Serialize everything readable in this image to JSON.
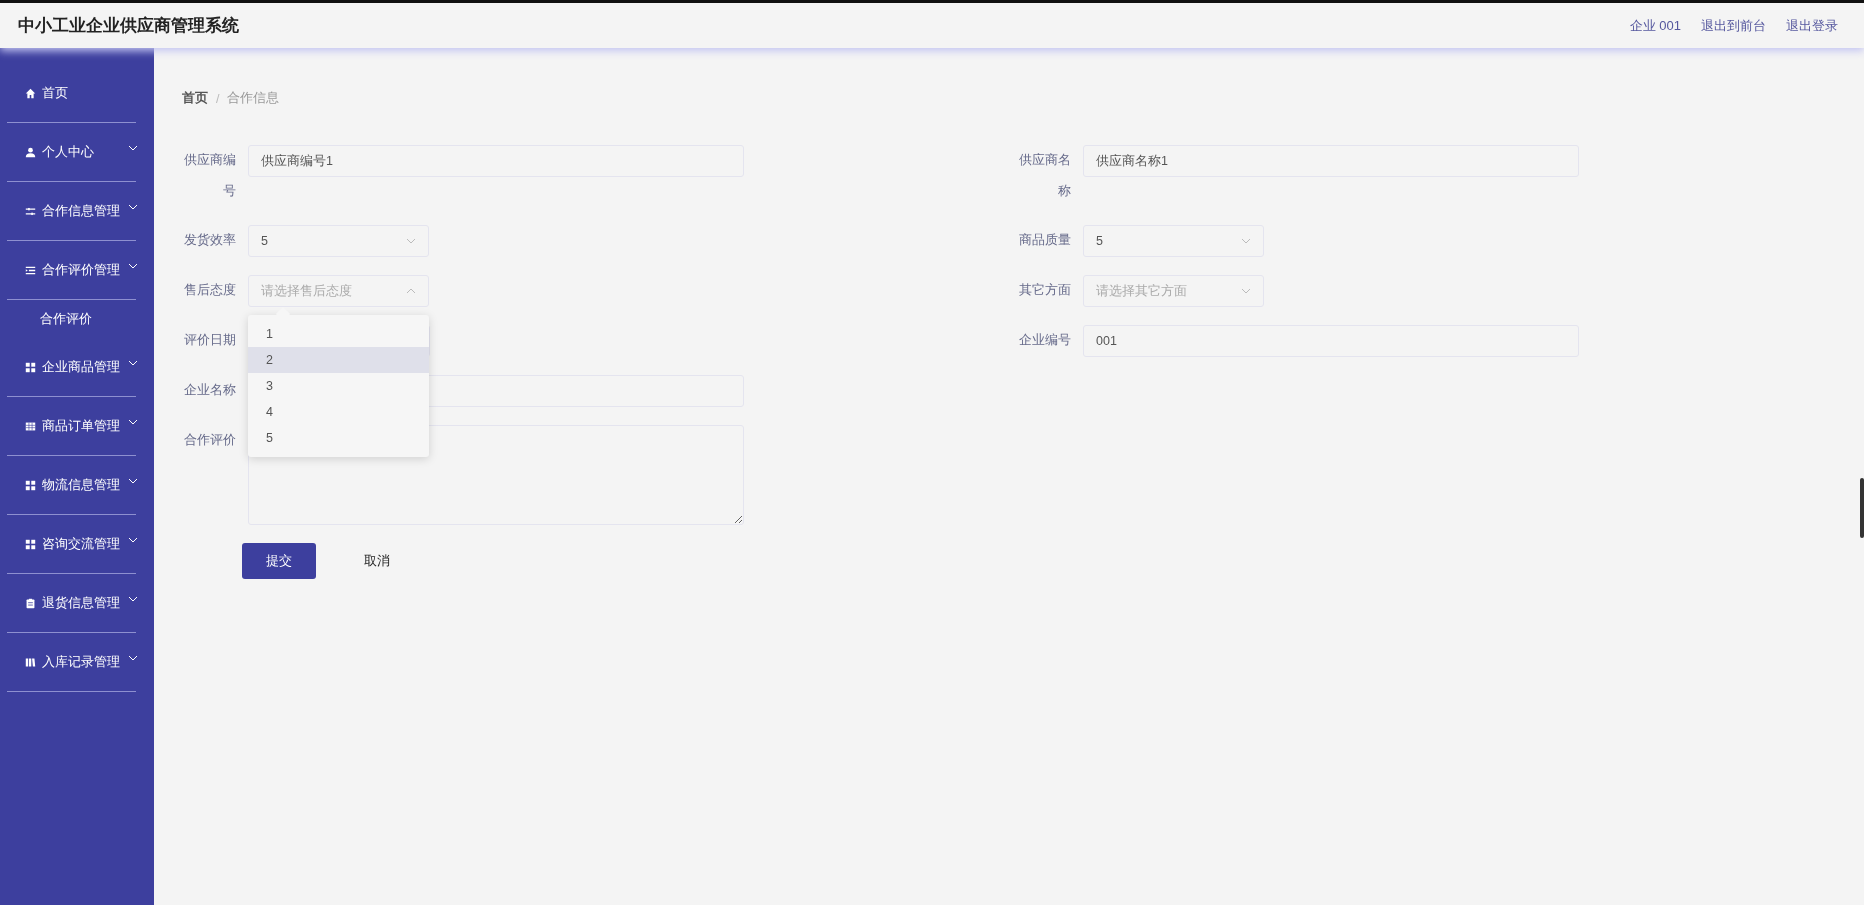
{
  "header": {
    "title": "中小工业企业供应商管理系统",
    "links": [
      "企业 001",
      "退出到前台",
      "退出登录"
    ]
  },
  "sidebar": {
    "items": [
      {
        "label": "首页",
        "expandable": false
      },
      {
        "label": "个人中心",
        "expandable": true
      },
      {
        "label": "合作信息管理",
        "expandable": true
      },
      {
        "label": "合作评价管理",
        "expandable": true,
        "children": [
          {
            "label": "合作评价"
          }
        ]
      },
      {
        "label": "企业商品管理",
        "expandable": true
      },
      {
        "label": "商品订单管理",
        "expandable": true
      },
      {
        "label": "物流信息管理",
        "expandable": true
      },
      {
        "label": "咨询交流管理",
        "expandable": true
      },
      {
        "label": "退货信息管理",
        "expandable": true
      },
      {
        "label": "入库记录管理",
        "expandable": true
      }
    ]
  },
  "breadcrumb": {
    "items": [
      "首页",
      "合作信息"
    ],
    "separator": "/"
  },
  "form": {
    "rows": [
      [
        {
          "kind": "text",
          "label": "供应商编号",
          "value": "供应商编号1"
        },
        {
          "kind": "text",
          "label": "供应商名称",
          "value": "供应商名称1"
        }
      ],
      [
        {
          "kind": "select",
          "label": "发货效率",
          "value": "5"
        },
        {
          "kind": "select",
          "label": "商品质量",
          "value": "5"
        }
      ],
      [
        {
          "kind": "select",
          "label": "售后态度",
          "placeholder": "请选择售后态度",
          "open": true
        },
        {
          "kind": "select",
          "label": "其它方面",
          "placeholder": "请选择其它方面",
          "open": false
        }
      ],
      [
        {
          "kind": "date",
          "label": "评价日期"
        },
        {
          "kind": "text",
          "label": "企业编号",
          "value": "001"
        }
      ],
      [
        {
          "kind": "text",
          "label": "企业名称"
        }
      ],
      [
        {
          "kind": "textarea",
          "label": "合作评价"
        }
      ]
    ],
    "dropdown": {
      "options": [
        {
          "label": "1",
          "hovered": false
        },
        {
          "label": "2",
          "hovered": true
        },
        {
          "label": "3",
          "hovered": false
        },
        {
          "label": "4",
          "hovered": false
        },
        {
          "label": "5",
          "hovered": false
        }
      ]
    },
    "buttons": [
      {
        "label": "提交",
        "primary": true
      },
      {
        "label": "取消",
        "primary": false
      }
    ]
  }
}
